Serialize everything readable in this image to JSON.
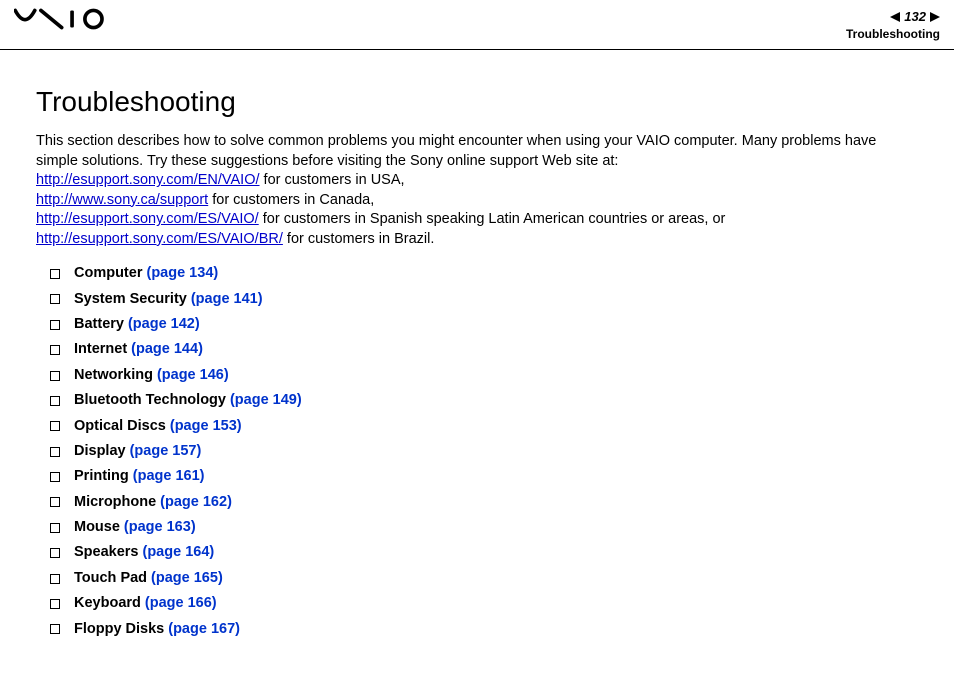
{
  "header": {
    "page_number": "132",
    "section_label": "Troubleshooting"
  },
  "title": "Troubleshooting",
  "intro": {
    "line1": "This section describes how to solve common problems you might encounter when using your VAIO computer. Many problems have simple solutions. Try these suggestions before visiting the Sony online support Web site at:",
    "links": [
      {
        "url": "http://esupport.sony.com/EN/VAIO/",
        "suffix": " for customers in USA,"
      },
      {
        "url": "http://www.sony.ca/support",
        "suffix": " for customers in Canada,"
      },
      {
        "url": "http://esupport.sony.com/ES/VAIO/",
        "suffix": " for customers in Spanish speaking Latin American countries or areas, or"
      },
      {
        "url": "http://esupport.sony.com/ES/VAIO/BR/",
        "suffix": " for customers in Brazil."
      }
    ]
  },
  "toc": [
    {
      "label": "Computer",
      "page": "(page 134)"
    },
    {
      "label": "System Security",
      "page": "(page 141)"
    },
    {
      "label": "Battery",
      "page": "(page 142)"
    },
    {
      "label": "Internet",
      "page": "(page 144)"
    },
    {
      "label": "Networking",
      "page": "(page 146)"
    },
    {
      "label": "Bluetooth Technology",
      "page": "(page 149)"
    },
    {
      "label": "Optical Discs",
      "page": "(page 153)"
    },
    {
      "label": "Display",
      "page": "(page 157)"
    },
    {
      "label": "Printing",
      "page": "(page 161)"
    },
    {
      "label": "Microphone",
      "page": "(page 162)"
    },
    {
      "label": "Mouse",
      "page": "(page 163)"
    },
    {
      "label": "Speakers",
      "page": "(page 164)"
    },
    {
      "label": "Touch Pad",
      "page": "(page 165)"
    },
    {
      "label": "Keyboard",
      "page": "(page 166)"
    },
    {
      "label": "Floppy Disks",
      "page": "(page 167)"
    }
  ]
}
